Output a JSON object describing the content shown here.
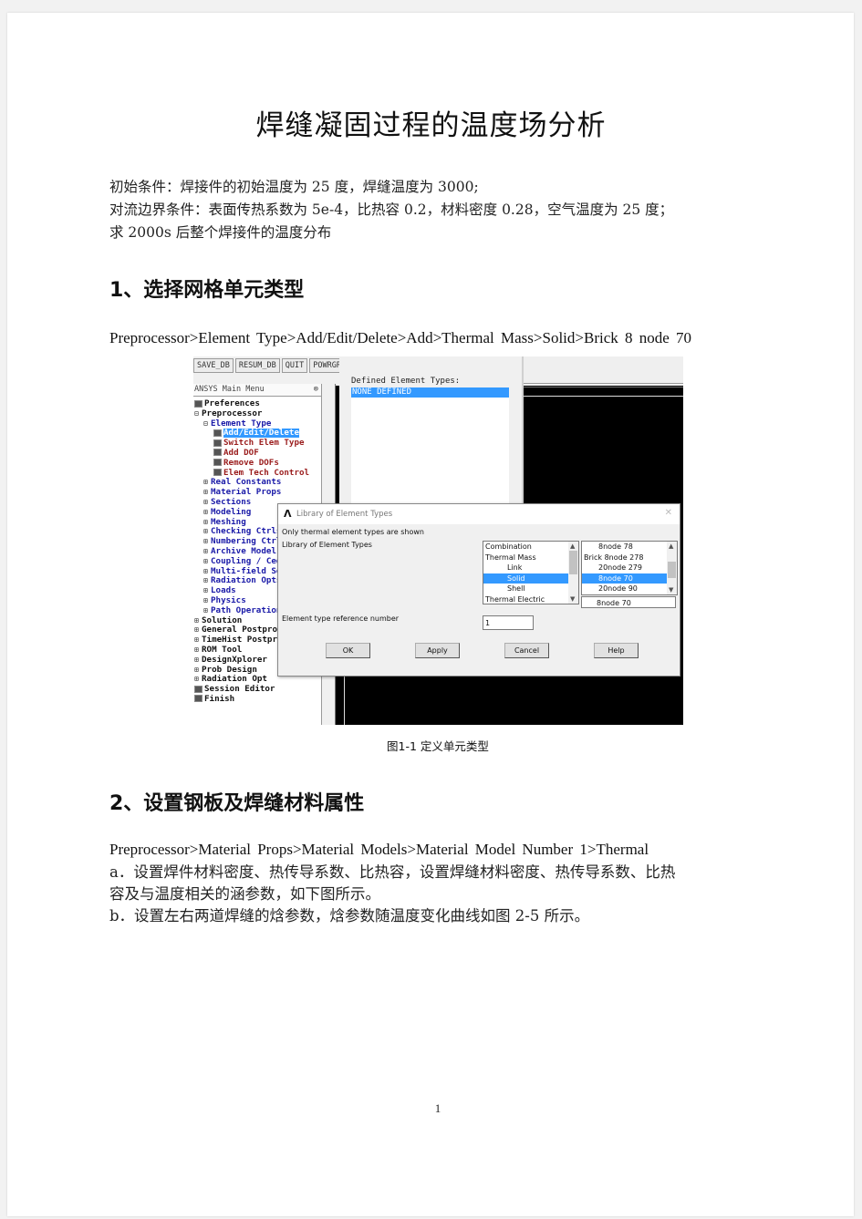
{
  "document": {
    "title": "焊缝凝固过程的温度场分析",
    "intro": [
      "初始条件：焊接件的初始温度为 25 度，焊缝温度为 3000;",
      "对流边界条件：表面传热系数为 5e-4，比热容 0.2，材料密度 0.28，空气温度为 25 度；",
      "求 2000s 后整个焊接件的温度分布"
    ],
    "sections": [
      {
        "heading": "1、选择网格单元类型",
        "path": "Preprocessor>Element Type>Add/Edit/Delete>Add>Thermal Mass>Solid>Brick 8 node 70"
      },
      {
        "heading": "2、设置钢板及焊缝材料属性",
        "path": "Preprocessor>Material Props>Material Models>Material Model Number 1>Thermal",
        "body": [
          "a．设置焊件材料密度、热传导系数、比热容，设置焊缝材料密度、热传导系数、比热",
          "容及与温度相关的涵参数，如下图所示。",
          "b．设置左右两道焊缝的焓参数，焓参数随温度变化曲线如图 2-5 所示。"
        ]
      }
    ],
    "figure_caption": "图1-1 定义单元类型",
    "page_number": "1"
  },
  "ansys": {
    "toolbar": [
      "SAVE_DB",
      "RESUM_DB",
      "QUIT",
      "POWRGRPH"
    ],
    "main_menu_title": "ANSYS Main Menu",
    "tree": [
      {
        "label": "Preferences",
        "level": 0,
        "kind": "leaf",
        "color": "black"
      },
      {
        "label": "Preprocessor",
        "level": 0,
        "kind": "open",
        "color": "black"
      },
      {
        "label": "Element Type",
        "level": 1,
        "kind": "open",
        "color": "blue"
      },
      {
        "label": "Add/Edit/Delete",
        "level": 2,
        "kind": "leaf",
        "color": "red",
        "selected": true
      },
      {
        "label": "Switch Elem Type",
        "level": 2,
        "kind": "leaf",
        "color": "red"
      },
      {
        "label": "Add DOF",
        "level": 2,
        "kind": "leaf",
        "color": "red"
      },
      {
        "label": "Remove DOFs",
        "level": 2,
        "kind": "leaf",
        "color": "red"
      },
      {
        "label": "Elem Tech Control",
        "level": 2,
        "kind": "leaf",
        "color": "red"
      },
      {
        "label": "Real Constants",
        "level": 1,
        "kind": "closed",
        "color": "blue"
      },
      {
        "label": "Material Props",
        "level": 1,
        "kind": "closed",
        "color": "blue"
      },
      {
        "label": "Sections",
        "level": 1,
        "kind": "closed",
        "color": "blue"
      },
      {
        "label": "Modeling",
        "level": 1,
        "kind": "closed",
        "color": "blue"
      },
      {
        "label": "Meshing",
        "level": 1,
        "kind": "closed",
        "color": "blue"
      },
      {
        "label": "Checking Ctrls",
        "level": 1,
        "kind": "closed",
        "color": "blue"
      },
      {
        "label": "Numbering Ctrls",
        "level": 1,
        "kind": "closed",
        "color": "blue"
      },
      {
        "label": "Archive Model",
        "level": 1,
        "kind": "closed",
        "color": "blue"
      },
      {
        "label": "Coupling / Ceqn",
        "level": 1,
        "kind": "closed",
        "color": "blue"
      },
      {
        "label": "Multi-field Set Up",
        "level": 1,
        "kind": "closed",
        "color": "blue"
      },
      {
        "label": "Radiation Opts",
        "level": 1,
        "kind": "closed",
        "color": "blue"
      },
      {
        "label": "Loads",
        "level": 1,
        "kind": "closed",
        "color": "blue"
      },
      {
        "label": "Physics",
        "level": 1,
        "kind": "closed",
        "color": "blue"
      },
      {
        "label": "Path Operations",
        "level": 1,
        "kind": "closed",
        "color": "blue"
      },
      {
        "label": "Solution",
        "level": 0,
        "kind": "closed",
        "color": "black"
      },
      {
        "label": "General Postproc",
        "level": 0,
        "kind": "closed",
        "color": "black"
      },
      {
        "label": "TimeHist Postpro",
        "level": 0,
        "kind": "closed",
        "color": "black"
      },
      {
        "label": "ROM Tool",
        "level": 0,
        "kind": "closed",
        "color": "black"
      },
      {
        "label": "DesignXplorer",
        "level": 0,
        "kind": "closed",
        "color": "black"
      },
      {
        "label": "Prob Design",
        "level": 0,
        "kind": "closed",
        "color": "black"
      },
      {
        "label": "Radiation Opt",
        "level": 0,
        "kind": "closed",
        "color": "black"
      },
      {
        "label": "Session Editor",
        "level": 0,
        "kind": "leaf",
        "color": "black"
      },
      {
        "label": "Finish",
        "level": 0,
        "kind": "leaf",
        "color": "black"
      }
    ],
    "element_types_dialog": {
      "label": "Defined Element Types:",
      "items": [
        "NONE DEFINED"
      ]
    },
    "library_dialog": {
      "title": "Library of Element Types",
      "note": "Only thermal element types are shown",
      "library_label": "Library of Element Types",
      "categories": [
        {
          "label": "Combination",
          "indent": false
        },
        {
          "label": "Thermal Mass",
          "indent": false
        },
        {
          "label": "Link",
          "indent": true
        },
        {
          "label": "Solid",
          "indent": true,
          "selected": true
        },
        {
          "label": "Shell",
          "indent": true
        },
        {
          "label": "Thermal Electric",
          "indent": false
        }
      ],
      "elements": [
        {
          "label": "8node 78",
          "indent": true
        },
        {
          "label": "Brick 8node  278",
          "indent": false
        },
        {
          "label": "20node 279",
          "indent": true
        },
        {
          "label": "8node  70",
          "indent": true,
          "selected": true
        },
        {
          "label": "20node  90",
          "indent": true
        }
      ],
      "selected_element": "8node  70",
      "ref_label": "Element type reference number",
      "ref_value": "1",
      "buttons": {
        "ok": "OK",
        "apply": "Apply",
        "cancel": "Cancel",
        "help": "Help"
      }
    }
  },
  "colors": {
    "selection": "#3399ff",
    "tree_blue": "#1a1aa8",
    "tree_red": "#9a1c1c",
    "graphics_bg": "#000000"
  }
}
